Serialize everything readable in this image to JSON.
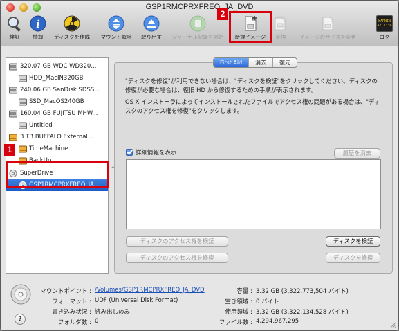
{
  "window": {
    "title": "GSP1RMCPRXFREO_JA_DVD"
  },
  "toolbar": {
    "items": [
      {
        "label": "検証",
        "icon": "verify-icon",
        "enabled": true
      },
      {
        "label": "情報",
        "icon": "info-icon",
        "enabled": true
      },
      {
        "label": "ディスクを作成",
        "icon": "burn-icon",
        "enabled": true
      },
      {
        "label": "マウント解除",
        "icon": "unmount-icon",
        "enabled": true
      },
      {
        "label": "取り出す",
        "icon": "eject-icon",
        "enabled": true
      },
      {
        "label": "ジャーナル記録を開始",
        "icon": "journal-icon",
        "enabled": false
      },
      {
        "label": "新規イメージ",
        "icon": "new-image-icon",
        "enabled": true
      },
      {
        "label": "変換",
        "icon": "convert-icon",
        "enabled": false
      },
      {
        "label": "イメージのサイズを変更",
        "icon": "resize-image-icon",
        "enabled": false
      },
      {
        "label": "ログ",
        "icon": "log-icon",
        "enabled": true
      }
    ],
    "log_icon_text": [
      "WARNIN",
      "AY 7:36"
    ]
  },
  "callouts": {
    "one": "1",
    "two": "2"
  },
  "sidebar": {
    "items": [
      {
        "label": "320.07 GB WDC WD320...",
        "type": "disk"
      },
      {
        "label": "HDD_MacIN320GB",
        "type": "volume"
      },
      {
        "label": "240.06 GB SanDisk SDSS...",
        "type": "disk"
      },
      {
        "label": "SSD_MacOS240GB",
        "type": "volume"
      },
      {
        "label": "160.04 GB FUJITSU MHW...",
        "type": "disk"
      },
      {
        "label": "Untitled",
        "type": "volume"
      },
      {
        "label": "3 TB BUFFALO External...",
        "type": "external-disk"
      },
      {
        "label": "TimeMachine",
        "type": "external-volume"
      },
      {
        "label": "BackUp",
        "type": "external-volume"
      },
      {
        "label": "SuperDrive",
        "type": "optical-drive"
      },
      {
        "label": "GSP1RMCPRXFREO_JA...",
        "type": "optical-disc",
        "selected": true
      }
    ]
  },
  "tabs": [
    {
      "label": "First Aid",
      "active": true
    },
    {
      "label": "消去",
      "active": false
    },
    {
      "label": "復元",
      "active": false
    }
  ],
  "first_aid": {
    "para1_line1": "\"ディスクを修復\"が利用できない場合は、\"ディスクを検証\"をクリックしてください。ディスクの",
    "para1_line2": "修復が必要な場合は、復旧 HD から修復するための手順が表示されます。",
    "para2_line1": "OS X インストーラによってインストールされたファイルでアクセス権の問題がある場合は、\"ディ",
    "para2_line2": "スクのアクセス権を修復\"をクリックします。",
    "show_details_label": "詳細情報を表示",
    "show_details_checked": true,
    "clear_history": "履歴を消去",
    "verify_permissions": "ディスクのアクセス権を検証",
    "repair_permissions": "ディスクのアクセス権を修復",
    "verify_disk": "ディスクを検証",
    "repair_disk": "ディスクを修復"
  },
  "info": {
    "mount_point_label": "マウントポイント :",
    "mount_point_value": "/Volumes/GSP1RMCPRXFREO_JA_DVD",
    "format_label": "フォーマット :",
    "format_value": "UDF (Universal Disk Format)",
    "write_label": "書き込み状況 :",
    "write_value": "読み出しのみ",
    "folders_label": "フォルダ数 :",
    "folders_value": "0",
    "capacity_label": "容量 :",
    "capacity_value": "3.32 GB (3,322,773,504 バイト)",
    "available_label": "空き領域 :",
    "available_value": "0 バイト",
    "used_label": "使用領域 :",
    "used_value": "3.32 GB (3,322,134,528 バイト)",
    "files_label": "ファイル数 :",
    "files_value": "4,294,967,295"
  },
  "help": "?"
}
